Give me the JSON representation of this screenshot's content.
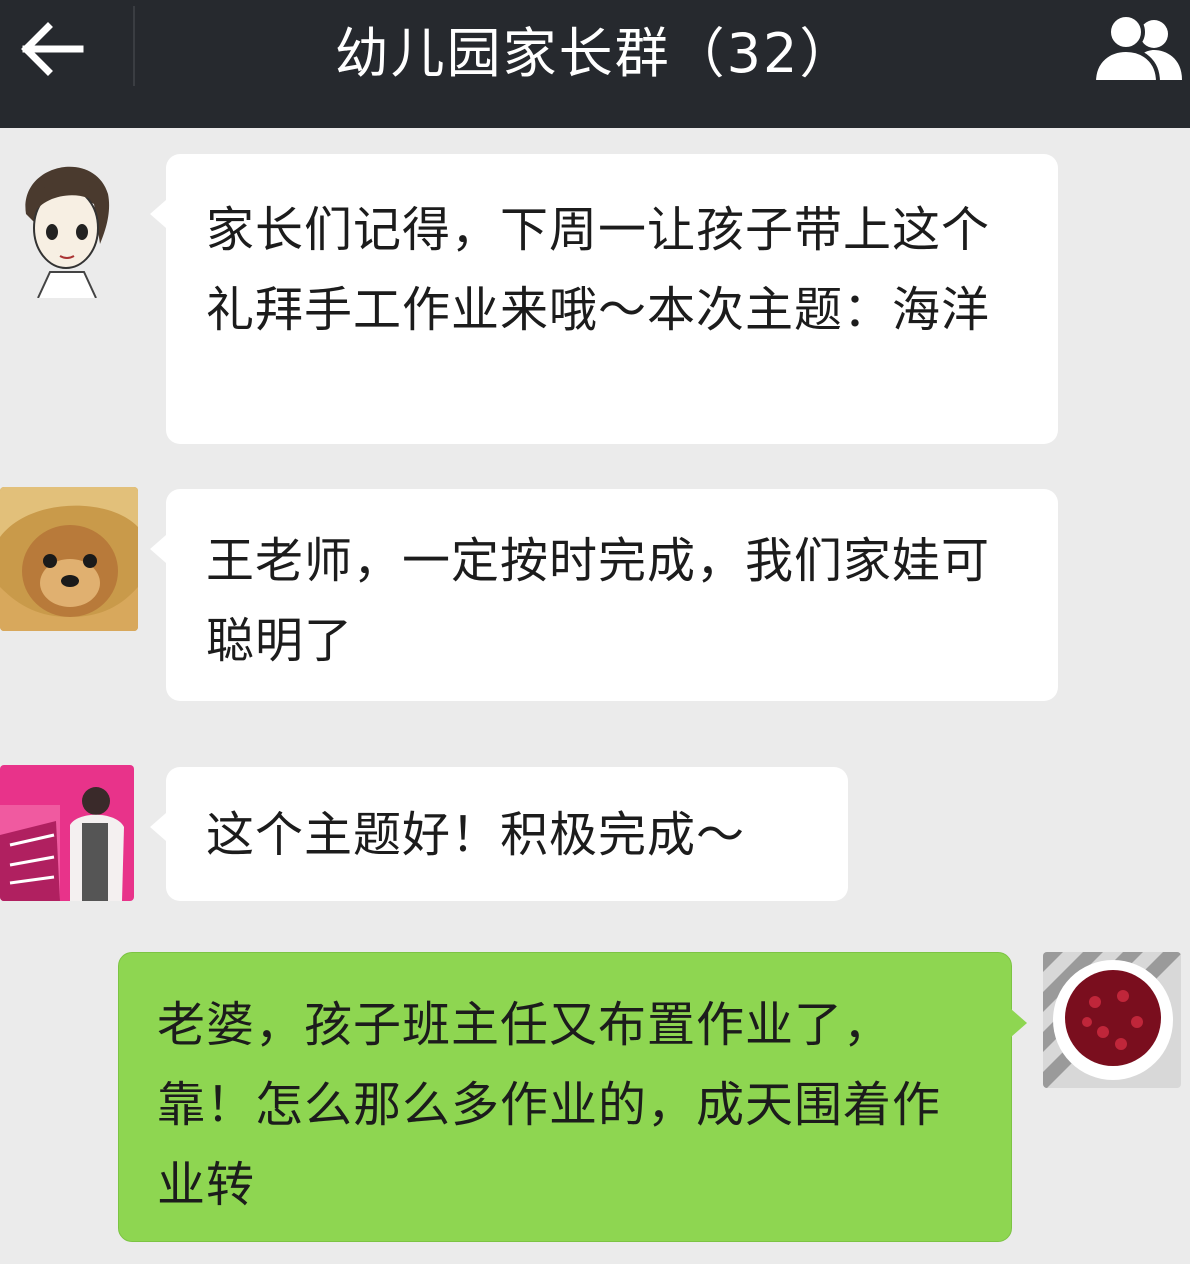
{
  "header": {
    "title": "幼儿园家长群（32）",
    "back_icon": "arrow-left-icon",
    "members_icon": "group-members-icon"
  },
  "messages": [
    {
      "side": "left",
      "avatar": "teacher-cartoon-avatar",
      "text": "家长们记得，下周一让孩子带上这个礼拜手工作业来哦～本次主题：海洋"
    },
    {
      "side": "left",
      "avatar": "dog-avatar",
      "text": "王老师，一定按时完成，我们家娃可聪明了"
    },
    {
      "side": "left",
      "avatar": "woman-photo-avatar",
      "text": "这个主题好！积极完成～"
    },
    {
      "side": "right",
      "avatar": "berries-bowl-avatar",
      "text": "老婆，孩子班主任又布置作业了，靠！怎么那么多作业的，成天围着作业转"
    }
  ],
  "colors": {
    "header_bg": "#26292e",
    "chat_bg": "#ebebeb",
    "incoming_bubble": "#ffffff",
    "outgoing_bubble": "#8ed651"
  }
}
